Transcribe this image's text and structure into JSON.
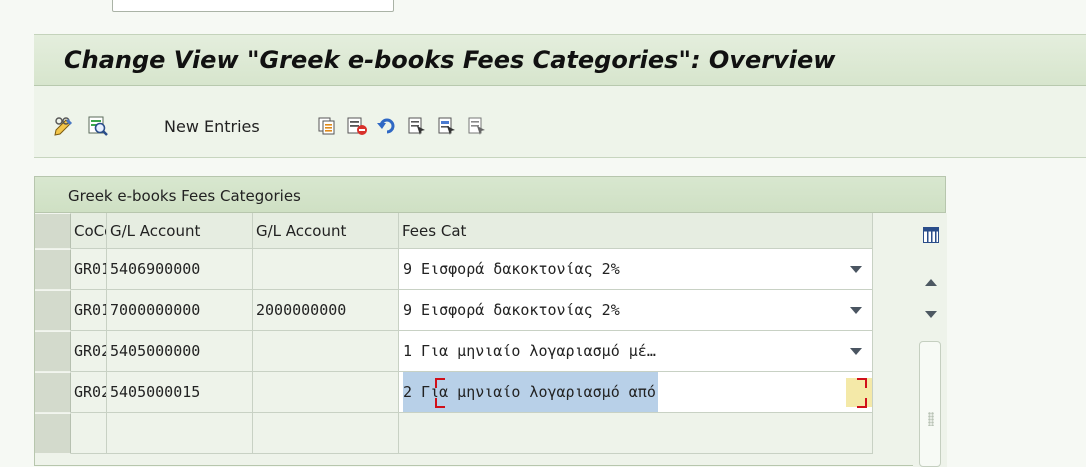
{
  "page": {
    "title": "Change View \"Greek e-books Fees Categories\": Overview"
  },
  "toolbar": {
    "new_entries_label": "New Entries"
  },
  "table": {
    "title": "Greek e-books Fees Categories",
    "columns": [
      "CoCd",
      "G/L Account",
      "G/L Account",
      "Fees Cat"
    ],
    "rows": [
      {
        "cocd": "GR01",
        "gl1": "5406900000",
        "gl2": "",
        "fees_cat": "9 Εισφορά δακοκτονίας 2%"
      },
      {
        "cocd": "GR01",
        "gl1": "7000000000",
        "gl2": "2000000000",
        "fees_cat": "9 Εισφορά δακοκτονίας 2%"
      },
      {
        "cocd": "GR02",
        "gl1": "5405000000",
        "gl2": "",
        "fees_cat": "1 Για μηνιαίο λογαριασμό μέ…"
      },
      {
        "cocd": "GR02",
        "gl1": "5405000015",
        "gl2": "",
        "fees_cat": "2 Για μηνιαίο λογαριασμό από"
      }
    ]
  },
  "colors": {
    "title_bar": "#d7e5cd",
    "focus_cell": "#b8d0e8",
    "focus_marker": "#d0101a"
  }
}
